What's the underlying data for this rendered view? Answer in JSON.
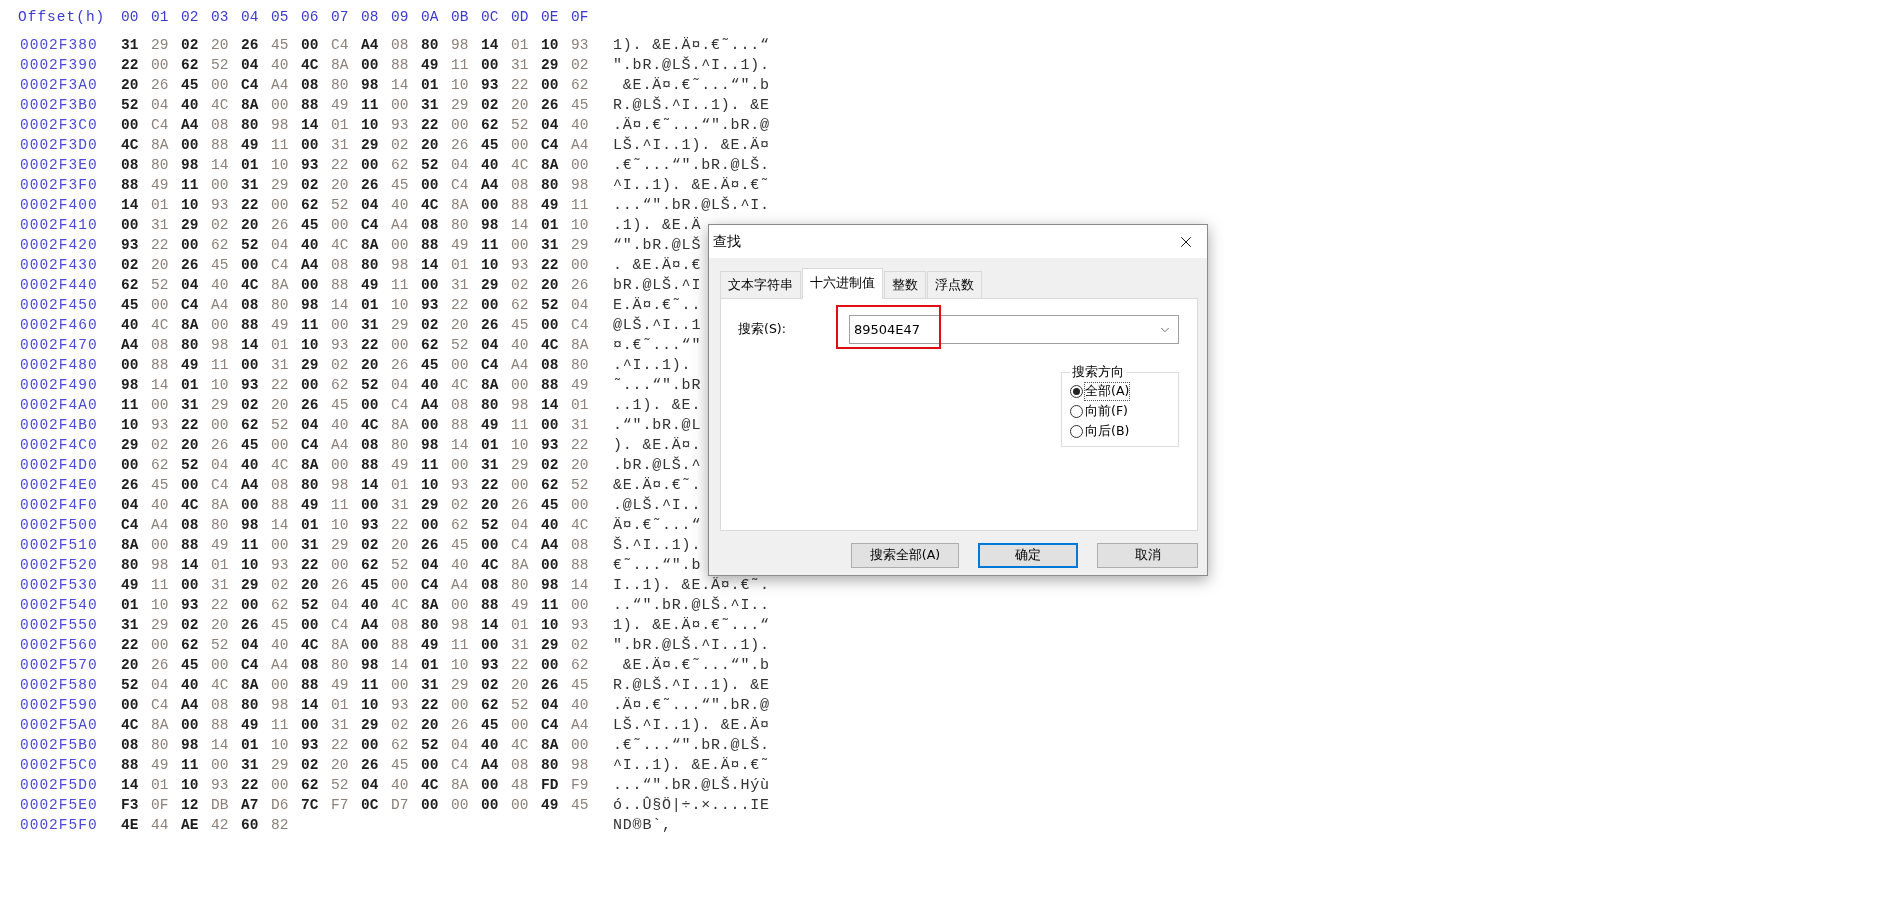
{
  "header": {
    "offset_label": "Offset(h)",
    "columns": [
      "00",
      "01",
      "02",
      "03",
      "04",
      "05",
      "06",
      "07",
      "08",
      "09",
      "0A",
      "0B",
      "0C",
      "0D",
      "0E",
      "0F"
    ]
  },
  "rows": [
    {
      "offset": "0002F380",
      "bytes": [
        "31",
        "29",
        "02",
        "20",
        "26",
        "45",
        "00",
        "C4",
        "A4",
        "08",
        "80",
        "98",
        "14",
        "01",
        "10",
        "93"
      ],
      "text": "1). &E.Ä¤.€˜...“"
    },
    {
      "offset": "0002F390",
      "bytes": [
        "22",
        "00",
        "62",
        "52",
        "04",
        "40",
        "4C",
        "8A",
        "00",
        "88",
        "49",
        "11",
        "00",
        "31",
        "29",
        "02"
      ],
      "text": "\".bR.@LŠ.^I..1)."
    },
    {
      "offset": "0002F3A0",
      "bytes": [
        "20",
        "26",
        "45",
        "00",
        "C4",
        "A4",
        "08",
        "80",
        "98",
        "14",
        "01",
        "10",
        "93",
        "22",
        "00",
        "62"
      ],
      "text": " &E.Ä¤.€˜...“\".b"
    },
    {
      "offset": "0002F3B0",
      "bytes": [
        "52",
        "04",
        "40",
        "4C",
        "8A",
        "00",
        "88",
        "49",
        "11",
        "00",
        "31",
        "29",
        "02",
        "20",
        "26",
        "45"
      ],
      "text": "R.@LŠ.^I..1). &E"
    },
    {
      "offset": "0002F3C0",
      "bytes": [
        "00",
        "C4",
        "A4",
        "08",
        "80",
        "98",
        "14",
        "01",
        "10",
        "93",
        "22",
        "00",
        "62",
        "52",
        "04",
        "40"
      ],
      "text": ".Ä¤.€˜...“\".bR.@"
    },
    {
      "offset": "0002F3D0",
      "bytes": [
        "4C",
        "8A",
        "00",
        "88",
        "49",
        "11",
        "00",
        "31",
        "29",
        "02",
        "20",
        "26",
        "45",
        "00",
        "C4",
        "A4"
      ],
      "text": "LŠ.^I..1). &E.Ä¤"
    },
    {
      "offset": "0002F3E0",
      "bytes": [
        "08",
        "80",
        "98",
        "14",
        "01",
        "10",
        "93",
        "22",
        "00",
        "62",
        "52",
        "04",
        "40",
        "4C",
        "8A",
        "00"
      ],
      "text": ".€˜...“\".bR.@LŠ."
    },
    {
      "offset": "0002F3F0",
      "bytes": [
        "88",
        "49",
        "11",
        "00",
        "31",
        "29",
        "02",
        "20",
        "26",
        "45",
        "00",
        "C4",
        "A4",
        "08",
        "80",
        "98"
      ],
      "text": "^I..1). &E.Ä¤.€˜"
    },
    {
      "offset": "0002F400",
      "bytes": [
        "14",
        "01",
        "10",
        "93",
        "22",
        "00",
        "62",
        "52",
        "04",
        "40",
        "4C",
        "8A",
        "00",
        "88",
        "49",
        "11"
      ],
      "text": "...“\".bR.@LŠ.^I."
    },
    {
      "offset": "0002F410",
      "bytes": [
        "00",
        "31",
        "29",
        "02",
        "20",
        "26",
        "45",
        "00",
        "C4",
        "A4",
        "08",
        "80",
        "98",
        "14",
        "01",
        "10"
      ],
      "text": ".1). &E.Ä"
    },
    {
      "offset": "0002F420",
      "bytes": [
        "93",
        "22",
        "00",
        "62",
        "52",
        "04",
        "40",
        "4C",
        "8A",
        "00",
        "88",
        "49",
        "11",
        "00",
        "31",
        "29"
      ],
      "text": "“\".bR.@LŠ"
    },
    {
      "offset": "0002F430",
      "bytes": [
        "02",
        "20",
        "26",
        "45",
        "00",
        "C4",
        "A4",
        "08",
        "80",
        "98",
        "14",
        "01",
        "10",
        "93",
        "22",
        "00"
      ],
      "text": ". &E.Ä¤.€"
    },
    {
      "offset": "0002F440",
      "bytes": [
        "62",
        "52",
        "04",
        "40",
        "4C",
        "8A",
        "00",
        "88",
        "49",
        "11",
        "00",
        "31",
        "29",
        "02",
        "20",
        "26"
      ],
      "text": "bR.@LŠ.^I"
    },
    {
      "offset": "0002F450",
      "bytes": [
        "45",
        "00",
        "C4",
        "A4",
        "08",
        "80",
        "98",
        "14",
        "01",
        "10",
        "93",
        "22",
        "00",
        "62",
        "52",
        "04"
      ],
      "text": "E.Ä¤.€˜.."
    },
    {
      "offset": "0002F460",
      "bytes": [
        "40",
        "4C",
        "8A",
        "00",
        "88",
        "49",
        "11",
        "00",
        "31",
        "29",
        "02",
        "20",
        "26",
        "45",
        "00",
        "C4"
      ],
      "text": "@LŠ.^I..1"
    },
    {
      "offset": "0002F470",
      "bytes": [
        "A4",
        "08",
        "80",
        "98",
        "14",
        "01",
        "10",
        "93",
        "22",
        "00",
        "62",
        "52",
        "04",
        "40",
        "4C",
        "8A"
      ],
      "text": "¤.€˜...“\""
    },
    {
      "offset": "0002F480",
      "bytes": [
        "00",
        "88",
        "49",
        "11",
        "00",
        "31",
        "29",
        "02",
        "20",
        "26",
        "45",
        "00",
        "C4",
        "A4",
        "08",
        "80"
      ],
      "text": ".^I..1)."
    },
    {
      "offset": "0002F490",
      "bytes": [
        "98",
        "14",
        "01",
        "10",
        "93",
        "22",
        "00",
        "62",
        "52",
        "04",
        "40",
        "4C",
        "8A",
        "00",
        "88",
        "49"
      ],
      "text": "˜...“\".bR"
    },
    {
      "offset": "0002F4A0",
      "bytes": [
        "11",
        "00",
        "31",
        "29",
        "02",
        "20",
        "26",
        "45",
        "00",
        "C4",
        "A4",
        "08",
        "80",
        "98",
        "14",
        "01"
      ],
      "text": "..1). &E."
    },
    {
      "offset": "0002F4B0",
      "bytes": [
        "10",
        "93",
        "22",
        "00",
        "62",
        "52",
        "04",
        "40",
        "4C",
        "8A",
        "00",
        "88",
        "49",
        "11",
        "00",
        "31"
      ],
      "text": ".“\".bR.@L"
    },
    {
      "offset": "0002F4C0",
      "bytes": [
        "29",
        "02",
        "20",
        "26",
        "45",
        "00",
        "C4",
        "A4",
        "08",
        "80",
        "98",
        "14",
        "01",
        "10",
        "93",
        "22"
      ],
      "text": "). &E.Ä¤."
    },
    {
      "offset": "0002F4D0",
      "bytes": [
        "00",
        "62",
        "52",
        "04",
        "40",
        "4C",
        "8A",
        "00",
        "88",
        "49",
        "11",
        "00",
        "31",
        "29",
        "02",
        "20"
      ],
      "text": ".bR.@LŠ.^"
    },
    {
      "offset": "0002F4E0",
      "bytes": [
        "26",
        "45",
        "00",
        "C4",
        "A4",
        "08",
        "80",
        "98",
        "14",
        "01",
        "10",
        "93",
        "22",
        "00",
        "62",
        "52"
      ],
      "text": "&E.Ä¤.€˜."
    },
    {
      "offset": "0002F4F0",
      "bytes": [
        "04",
        "40",
        "4C",
        "8A",
        "00",
        "88",
        "49",
        "11",
        "00",
        "31",
        "29",
        "02",
        "20",
        "26",
        "45",
        "00"
      ],
      "text": ".@LŠ.^I.."
    },
    {
      "offset": "0002F500",
      "bytes": [
        "C4",
        "A4",
        "08",
        "80",
        "98",
        "14",
        "01",
        "10",
        "93",
        "22",
        "00",
        "62",
        "52",
        "04",
        "40",
        "4C"
      ],
      "text": "Ä¤.€˜...“"
    },
    {
      "offset": "0002F510",
      "bytes": [
        "8A",
        "00",
        "88",
        "49",
        "11",
        "00",
        "31",
        "29",
        "02",
        "20",
        "26",
        "45",
        "00",
        "C4",
        "A4",
        "08"
      ],
      "text": "Š.^I..1)."
    },
    {
      "offset": "0002F520",
      "bytes": [
        "80",
        "98",
        "14",
        "01",
        "10",
        "93",
        "22",
        "00",
        "62",
        "52",
        "04",
        "40",
        "4C",
        "8A",
        "00",
        "88"
      ],
      "text": "€˜...“\".b"
    },
    {
      "offset": "0002F530",
      "bytes": [
        "49",
        "11",
        "00",
        "31",
        "29",
        "02",
        "20",
        "26",
        "45",
        "00",
        "C4",
        "A4",
        "08",
        "80",
        "98",
        "14"
      ],
      "text": "I..1). &E.Ä¤.€˜."
    },
    {
      "offset": "0002F540",
      "bytes": [
        "01",
        "10",
        "93",
        "22",
        "00",
        "62",
        "52",
        "04",
        "40",
        "4C",
        "8A",
        "00",
        "88",
        "49",
        "11",
        "00"
      ],
      "text": "..“\".bR.@LŠ.^I.."
    },
    {
      "offset": "0002F550",
      "bytes": [
        "31",
        "29",
        "02",
        "20",
        "26",
        "45",
        "00",
        "C4",
        "A4",
        "08",
        "80",
        "98",
        "14",
        "01",
        "10",
        "93"
      ],
      "text": "1). &E.Ä¤.€˜...“"
    },
    {
      "offset": "0002F560",
      "bytes": [
        "22",
        "00",
        "62",
        "52",
        "04",
        "40",
        "4C",
        "8A",
        "00",
        "88",
        "49",
        "11",
        "00",
        "31",
        "29",
        "02"
      ],
      "text": "\".bR.@LŠ.^I..1)."
    },
    {
      "offset": "0002F570",
      "bytes": [
        "20",
        "26",
        "45",
        "00",
        "C4",
        "A4",
        "08",
        "80",
        "98",
        "14",
        "01",
        "10",
        "93",
        "22",
        "00",
        "62"
      ],
      "text": " &E.Ä¤.€˜...“\".b"
    },
    {
      "offset": "0002F580",
      "bytes": [
        "52",
        "04",
        "40",
        "4C",
        "8A",
        "00",
        "88",
        "49",
        "11",
        "00",
        "31",
        "29",
        "02",
        "20",
        "26",
        "45"
      ],
      "text": "R.@LŠ.^I..1). &E"
    },
    {
      "offset": "0002F590",
      "bytes": [
        "00",
        "C4",
        "A4",
        "08",
        "80",
        "98",
        "14",
        "01",
        "10",
        "93",
        "22",
        "00",
        "62",
        "52",
        "04",
        "40"
      ],
      "text": ".Ä¤.€˜...“\".bR.@"
    },
    {
      "offset": "0002F5A0",
      "bytes": [
        "4C",
        "8A",
        "00",
        "88",
        "49",
        "11",
        "00",
        "31",
        "29",
        "02",
        "20",
        "26",
        "45",
        "00",
        "C4",
        "A4"
      ],
      "text": "LŠ.^I..1). &E.Ä¤"
    },
    {
      "offset": "0002F5B0",
      "bytes": [
        "08",
        "80",
        "98",
        "14",
        "01",
        "10",
        "93",
        "22",
        "00",
        "62",
        "52",
        "04",
        "40",
        "4C",
        "8A",
        "00"
      ],
      "text": ".€˜...“\".bR.@LŠ."
    },
    {
      "offset": "0002F5C0",
      "bytes": [
        "88",
        "49",
        "11",
        "00",
        "31",
        "29",
        "02",
        "20",
        "26",
        "45",
        "00",
        "C4",
        "A4",
        "08",
        "80",
        "98"
      ],
      "text": "^I..1). &E.Ä¤.€˜"
    },
    {
      "offset": "0002F5D0",
      "bytes": [
        "14",
        "01",
        "10",
        "93",
        "22",
        "00",
        "62",
        "52",
        "04",
        "40",
        "4C",
        "8A",
        "00",
        "48",
        "FD",
        "F9"
      ],
      "text": "...“\".bR.@LŠ.Hýù"
    },
    {
      "offset": "0002F5E0",
      "bytes": [
        "F3",
        "0F",
        "12",
        "DB",
        "A7",
        "D6",
        "7C",
        "F7",
        "0C",
        "D7",
        "00",
        "00",
        "00",
        "00",
        "49",
        "45"
      ],
      "text": "ó..Û§Ö|÷.×....IE"
    },
    {
      "offset": "0002F5F0",
      "bytes": [
        "4E",
        "44",
        "AE",
        "42",
        "60",
        "82"
      ],
      "text": "ND®B`,"
    }
  ],
  "find_dialog": {
    "title": "查找",
    "tabs": [
      {
        "label": "文本字符串",
        "selected": false
      },
      {
        "label": "十六进制值",
        "selected": true
      },
      {
        "label": "整数",
        "selected": false
      },
      {
        "label": "浮点数",
        "selected": false
      }
    ],
    "search_label": "搜索(S):",
    "search_value": "89504E47",
    "search_highlighted": true,
    "direction_group": {
      "title": "搜索方向",
      "options": [
        {
          "label": "全部(A)",
          "selected": true
        },
        {
          "label": "向前(F)",
          "selected": false
        },
        {
          "label": "向后(B)",
          "selected": false
        }
      ]
    },
    "buttons": [
      {
        "label": "搜索全部(A)",
        "default": false
      },
      {
        "label": "确定",
        "default": true
      },
      {
        "label": "取消",
        "default": false
      }
    ]
  }
}
